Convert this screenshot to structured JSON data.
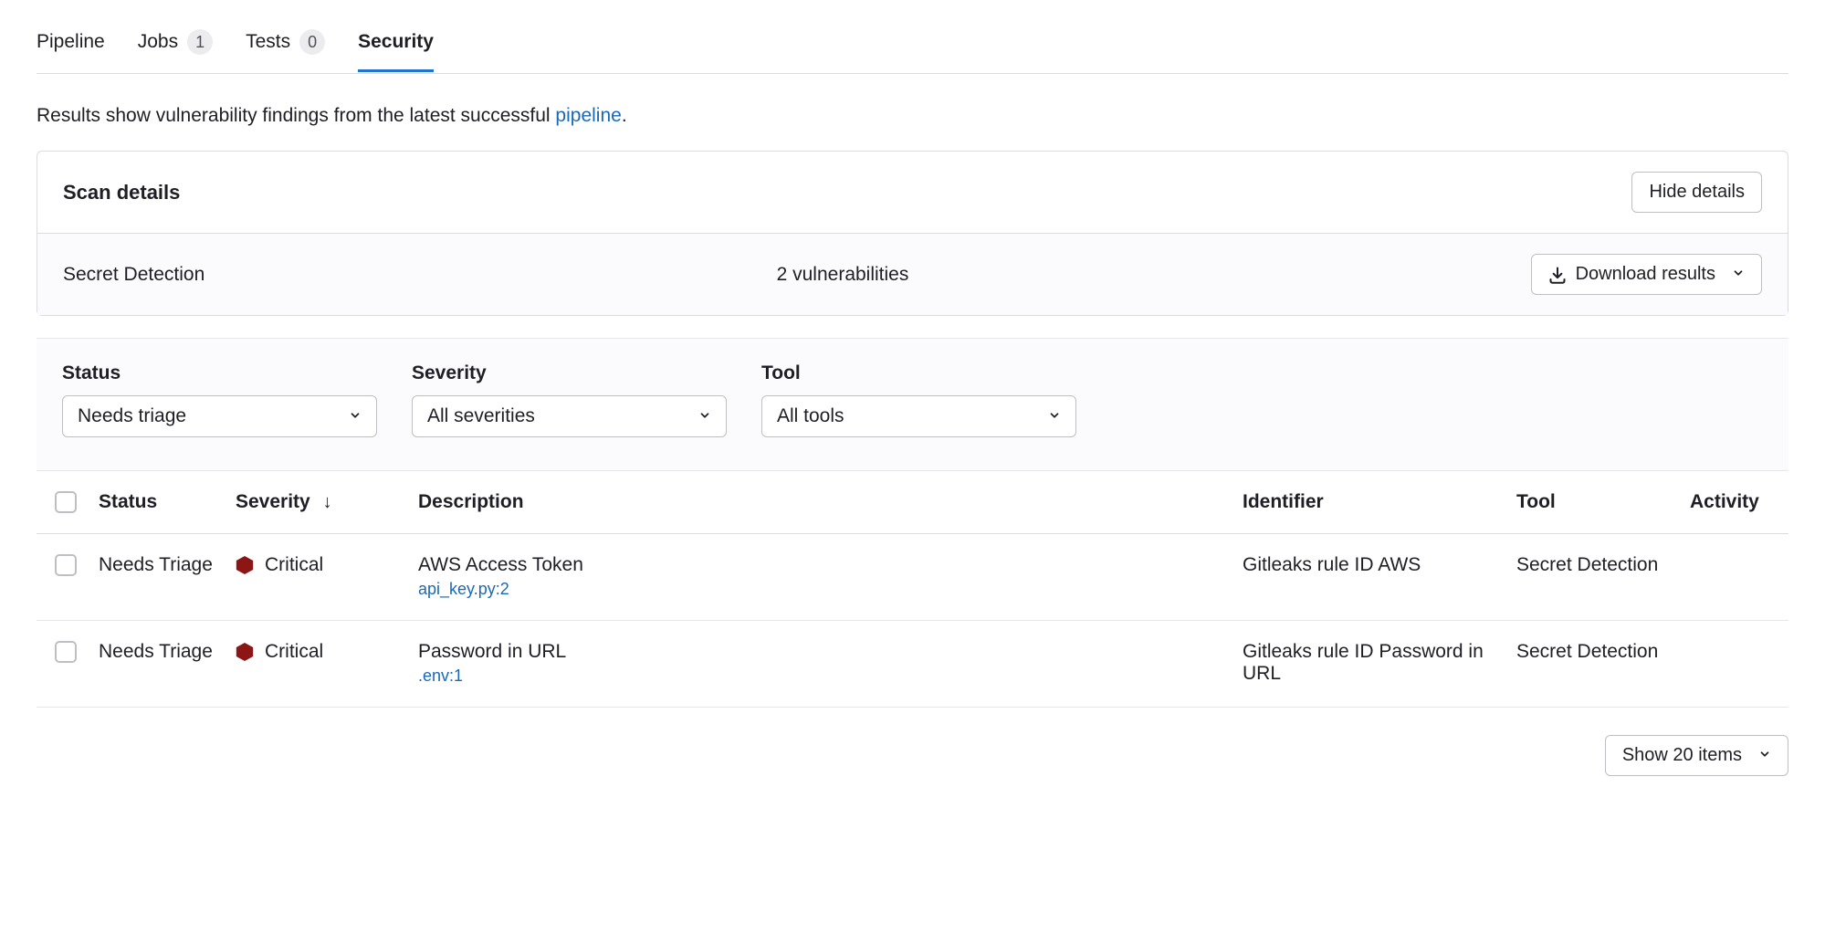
{
  "tabs": {
    "pipeline": "Pipeline",
    "jobs": "Jobs",
    "jobs_badge": "1",
    "tests": "Tests",
    "tests_badge": "0",
    "security": "Security"
  },
  "intro": {
    "prefix": "Results show vulnerability findings from the latest successful ",
    "link": "pipeline",
    "suffix": "."
  },
  "scan_panel": {
    "title": "Scan details",
    "hide_button": "Hide details",
    "scan_name": "Secret Detection",
    "scan_count": "2 vulnerabilities",
    "download_button": "Download results"
  },
  "filters": {
    "status": {
      "label": "Status",
      "value": "Needs triage"
    },
    "severity": {
      "label": "Severity",
      "value": "All severities"
    },
    "tool": {
      "label": "Tool",
      "value": "All tools"
    }
  },
  "table": {
    "headers": {
      "status": "Status",
      "severity": "Severity",
      "description": "Description",
      "identifier": "Identifier",
      "tool": "Tool",
      "activity": "Activity"
    },
    "rows": [
      {
        "status": "Needs Triage",
        "severity": "Critical",
        "severity_color": "#8c1515",
        "description": "AWS Access Token",
        "location": "api_key.py:2",
        "identifier": "Gitleaks rule ID AWS",
        "tool": "Secret Detection"
      },
      {
        "status": "Needs Triage",
        "severity": "Critical",
        "severity_color": "#8c1515",
        "description": "Password in URL",
        "location": ".env:1",
        "identifier": "Gitleaks rule ID Password in URL",
        "tool": "Secret Detection"
      }
    ]
  },
  "footer": {
    "show_items": "Show 20 items"
  }
}
